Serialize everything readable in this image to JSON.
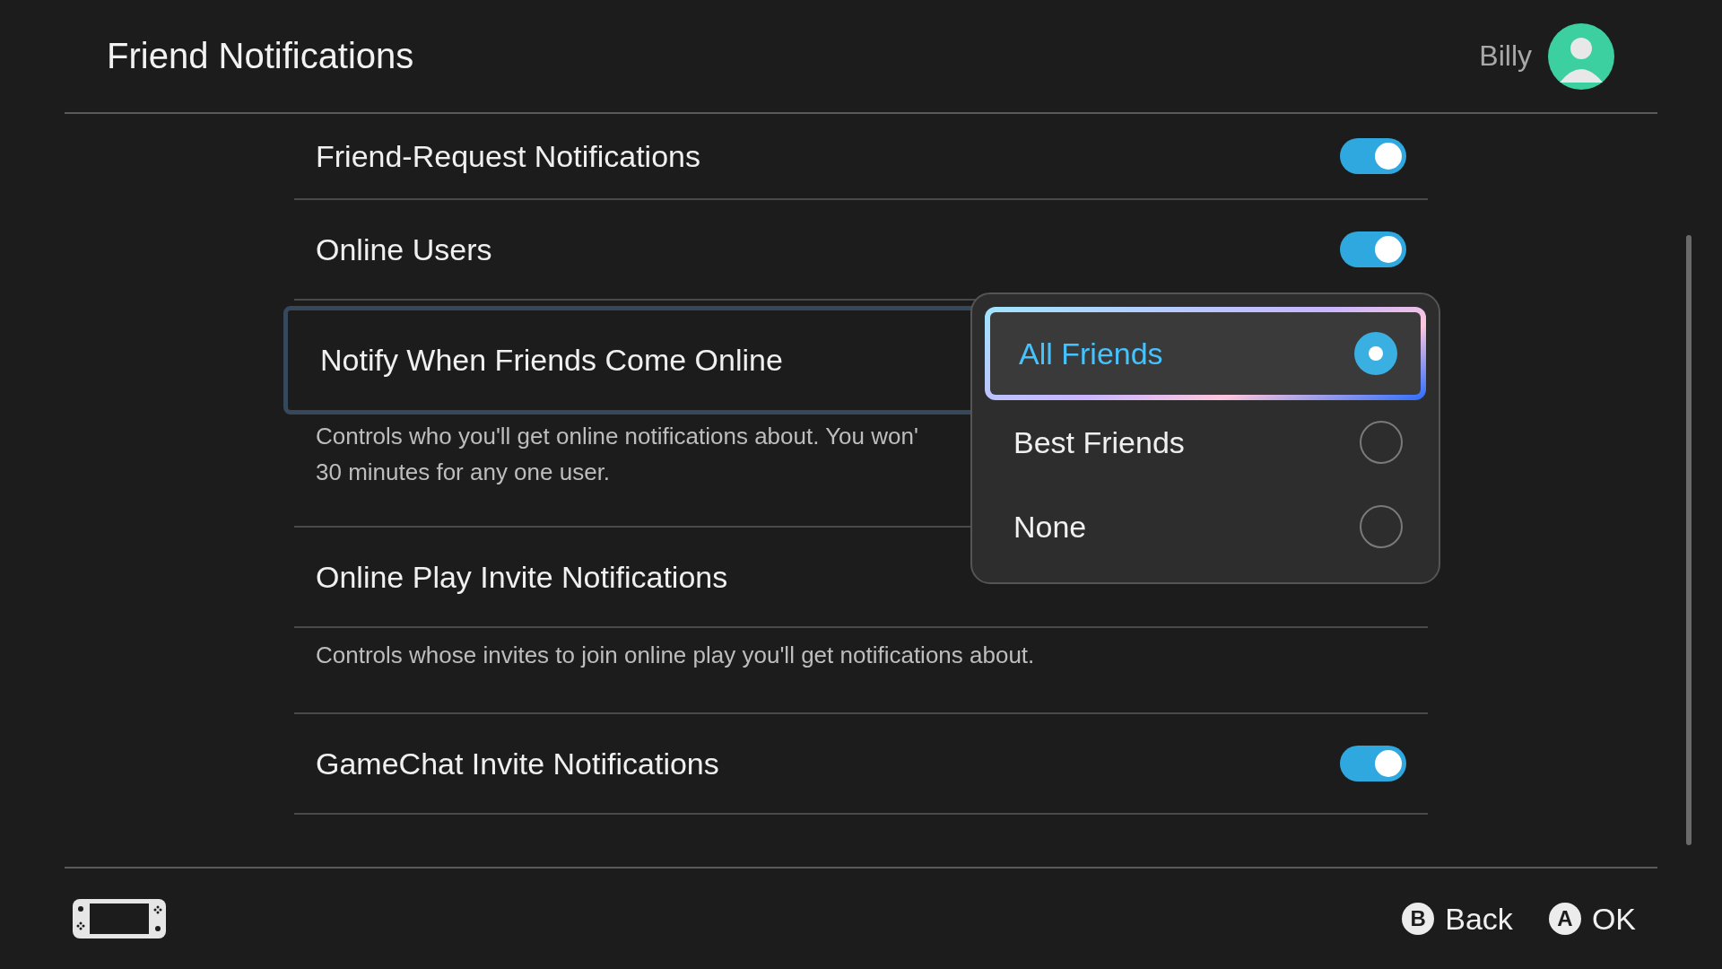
{
  "header": {
    "title": "Friend Notifications",
    "user_name": "Billy"
  },
  "settings": [
    {
      "kind": "toggle",
      "label": "Friend-Request Notifications",
      "on": true,
      "selected": false
    },
    {
      "kind": "toggle",
      "label": "Online Users",
      "on": true,
      "selected": false
    },
    {
      "kind": "choice",
      "label": "Notify When Friends Come Online",
      "selected": true,
      "description_lines": [
        "Controls who you'll get online notifications about. You won'",
        "30 minutes for any one user."
      ]
    },
    {
      "kind": "choice",
      "label": "Online Play Invite Notifications",
      "selected": false,
      "description_lines": [
        "Controls whose invites to join online play you'll get notifications about."
      ]
    },
    {
      "kind": "toggle",
      "label": "GameChat Invite Notifications",
      "on": true,
      "selected": false
    }
  ],
  "popup": {
    "options": [
      {
        "label": "All Friends",
        "selected": true
      },
      {
        "label": "Best Friends",
        "selected": false
      },
      {
        "label": "None",
        "selected": false
      }
    ]
  },
  "footer": {
    "buttons": [
      {
        "key": "B",
        "label": "Back"
      },
      {
        "key": "A",
        "label": "OK"
      }
    ]
  }
}
